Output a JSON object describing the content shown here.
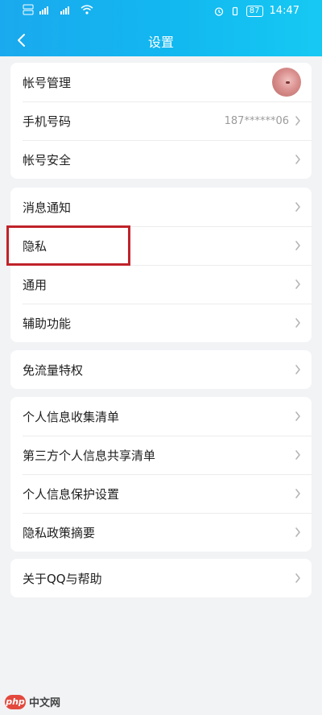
{
  "status_bar": {
    "time": "14:47",
    "battery": "87"
  },
  "nav": {
    "title": "设置"
  },
  "groups": [
    {
      "items": [
        {
          "label": "帐号管理",
          "value": ""
        },
        {
          "label": "手机号码",
          "value": "187******06"
        },
        {
          "label": "帐号安全",
          "value": ""
        }
      ]
    },
    {
      "items": [
        {
          "label": "消息通知",
          "value": ""
        },
        {
          "label": "隐私",
          "value": ""
        },
        {
          "label": "通用",
          "value": ""
        },
        {
          "label": "辅助功能",
          "value": ""
        }
      ]
    },
    {
      "items": [
        {
          "label": "免流量特权",
          "value": ""
        }
      ]
    },
    {
      "items": [
        {
          "label": "个人信息收集清单",
          "value": ""
        },
        {
          "label": "第三方个人信息共享清单",
          "value": ""
        },
        {
          "label": "个人信息保护设置",
          "value": ""
        },
        {
          "label": "隐私政策摘要",
          "value": ""
        }
      ]
    },
    {
      "items": [
        {
          "label": "关于QQ与帮助",
          "value": ""
        }
      ]
    }
  ],
  "watermark": {
    "badge": "php",
    "text": "中文网"
  },
  "colors": {
    "header_start": "#1aa9ee",
    "header_end": "#16c9f3",
    "highlight": "#c0232a",
    "background": "#f2f3f5"
  }
}
